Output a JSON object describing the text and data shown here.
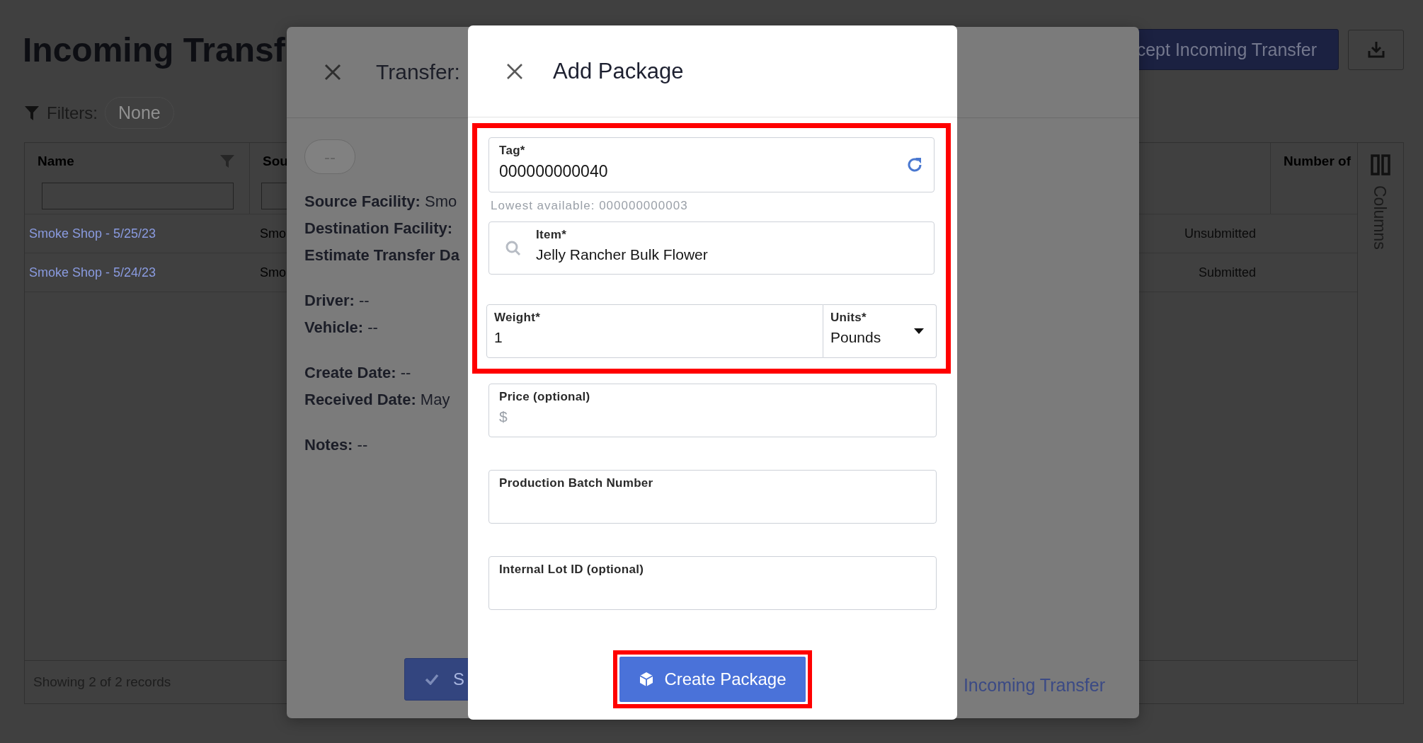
{
  "page": {
    "title": "Incoming Transf",
    "accept_button": "cept Incoming Transfer",
    "filters": {
      "label": "Filters:",
      "value": "None"
    }
  },
  "table": {
    "columns": [
      {
        "label": "Name",
        "filter": true
      },
      {
        "label": "Sou",
        "filter": false
      },
      {
        "label": "Number of",
        "filter": false
      }
    ],
    "rows": [
      {
        "name": "Smoke Shop - 5/25/23",
        "source": "Smo",
        "status": "Unsubmitted"
      },
      {
        "name": "Smoke Shop - 5/24/23",
        "source": "Smo",
        "status": "Submitted"
      }
    ],
    "footer": "Showing 2 of 2 records",
    "columns_toggle": "Columns"
  },
  "transfer_dialog": {
    "title": "Transfer:",
    "status_pill": "--",
    "groups": [
      {
        "lines": [
          "**Source Facility:** Smo",
          "**Destination Facility:**",
          "**Estimate Transfer Da**"
        ]
      },
      {
        "lines": [
          "**Driver:** --",
          "**Vehicle:** --"
        ]
      },
      {
        "lines": [
          "**Create Date:** --",
          "**Received Date:** May"
        ]
      },
      {
        "lines": [
          "**Notes:** --"
        ]
      }
    ],
    "submit_button": "S",
    "link": "Incoming Transfer"
  },
  "add_package_dialog": {
    "title": "Add Package",
    "highlighted": true,
    "tag": {
      "label": "Tag*",
      "value": "000000000040",
      "hint": "Lowest available: 000000000003"
    },
    "item": {
      "label": "Item*",
      "value": "Jelly Rancher Bulk Flower"
    },
    "weight": {
      "label": "Weight*",
      "value": "1"
    },
    "units": {
      "label": "Units*",
      "value": "Pounds"
    },
    "price": {
      "label": "Price (optional)",
      "placeholder": "$"
    },
    "optional_fields": [
      {
        "label": "Production Batch Number"
      },
      {
        "label": "Internal Lot ID (optional)"
      }
    ],
    "create_button": {
      "label": "Create Package",
      "highlighted": true
    }
  }
}
